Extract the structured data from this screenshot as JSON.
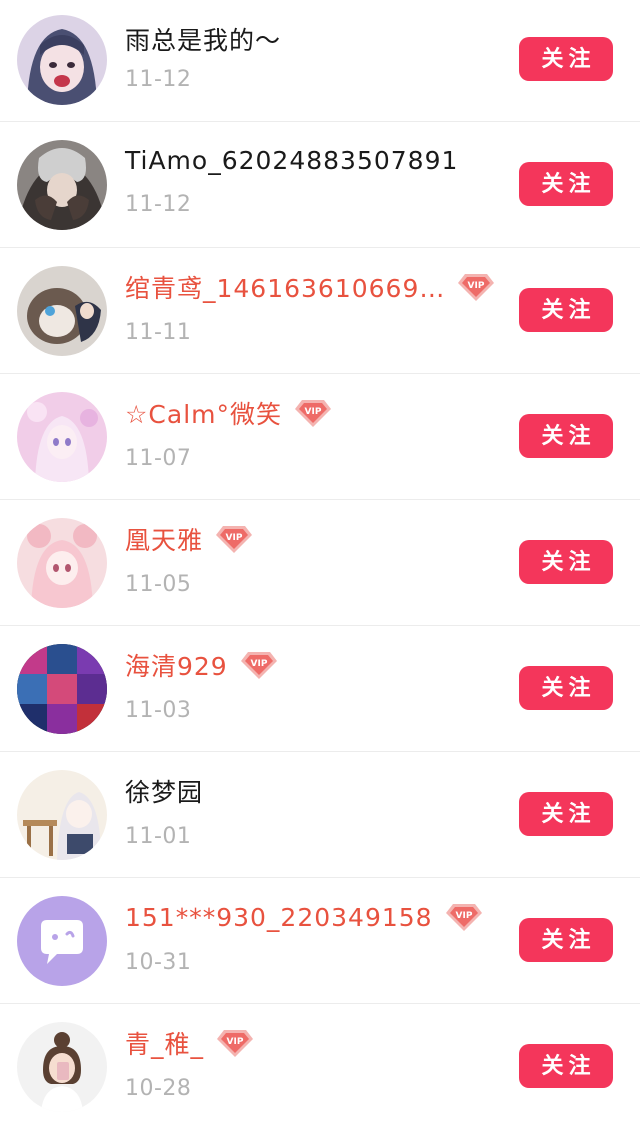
{
  "follow_label": "关注",
  "vip_badge_text": "VIP",
  "colors": {
    "follow_button": "#f4365b",
    "vip_name": "#e8523f",
    "date": "#b3b3b3",
    "name": "#1a1a1a"
  },
  "users": [
    {
      "name": "雨总是我的～",
      "date": "11-12",
      "vip": false,
      "avatar": "anime-avatar-icon"
    },
    {
      "name": "TiAmo_62024883507891",
      "date": "11-12",
      "vip": false,
      "avatar": "anime-avatar-icon"
    },
    {
      "name": "绾青鸢_146163610669…",
      "date": "11-11",
      "vip": true,
      "avatar": "anime-avatar-icon"
    },
    {
      "name": "☆Calm°微笑",
      "date": "11-07",
      "vip": true,
      "avatar": "anime-avatar-icon"
    },
    {
      "name": "凰天雅",
      "date": "11-05",
      "vip": true,
      "avatar": "anime-avatar-icon"
    },
    {
      "name": "海清929",
      "date": "11-03",
      "vip": true,
      "avatar": "collage-avatar-icon"
    },
    {
      "name": "徐梦园",
      "date": "11-01",
      "vip": false,
      "avatar": "anime-avatar-icon"
    },
    {
      "name": "151***930_220349158",
      "date": "10-31",
      "vip": true,
      "avatar": "default-chat-avatar-icon"
    },
    {
      "name": "青_稚_",
      "date": "10-28",
      "vip": true,
      "avatar": "photo-avatar-icon"
    }
  ]
}
